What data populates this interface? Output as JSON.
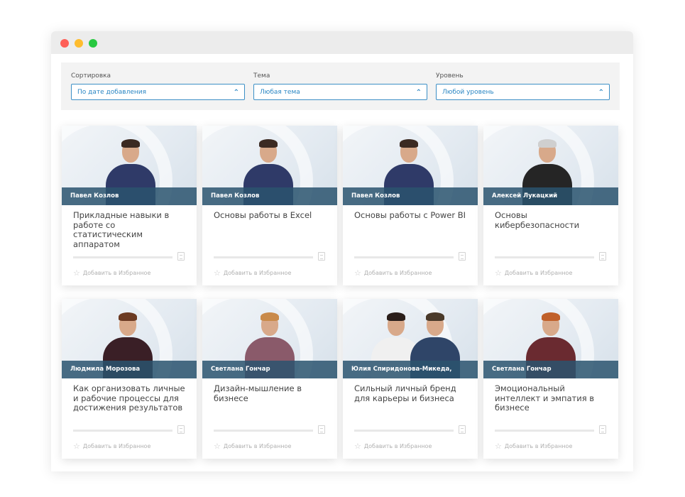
{
  "filters": [
    {
      "label": "Сортировка",
      "value": "По дате добавления"
    },
    {
      "label": "Тема",
      "value": "Любая тема"
    },
    {
      "label": "Уровень",
      "value": "Любой уровень"
    }
  ],
  "favorite_label": "Добавить в Избранное",
  "icons": {
    "chevron": "chevron-up-icon",
    "star": "star-icon",
    "doc": "document-icon"
  },
  "colors": {
    "accent": "#2a86c3",
    "namebar": "#2a536e"
  },
  "courses": [
    {
      "author": "Павел Козлов",
      "title": "Прикладные навыки в работе со статистическим аппаратом"
    },
    {
      "author": "Павел Козлов",
      "title": "Основы работы в Excel"
    },
    {
      "author": "Павел Козлов",
      "title": "Основы работы с Power BI"
    },
    {
      "author": "Алексей Лукацкий",
      "title": "Основы кибербезопасности"
    },
    {
      "author": "Людмила Морозова",
      "title": "Как организовать личные и рабочие процессы для достижения результатов"
    },
    {
      "author": "Светлана Гончар",
      "title": "Дизайн-мышление в бизнесе"
    },
    {
      "author": "Юлия Спиридонова-Микеда,",
      "title": "Сильный личный бренд для карьеры и бизнеса"
    },
    {
      "author": "Светлана Гончар",
      "title": "Эмоциональный интеллект и эмпатия в бизнесе"
    }
  ]
}
